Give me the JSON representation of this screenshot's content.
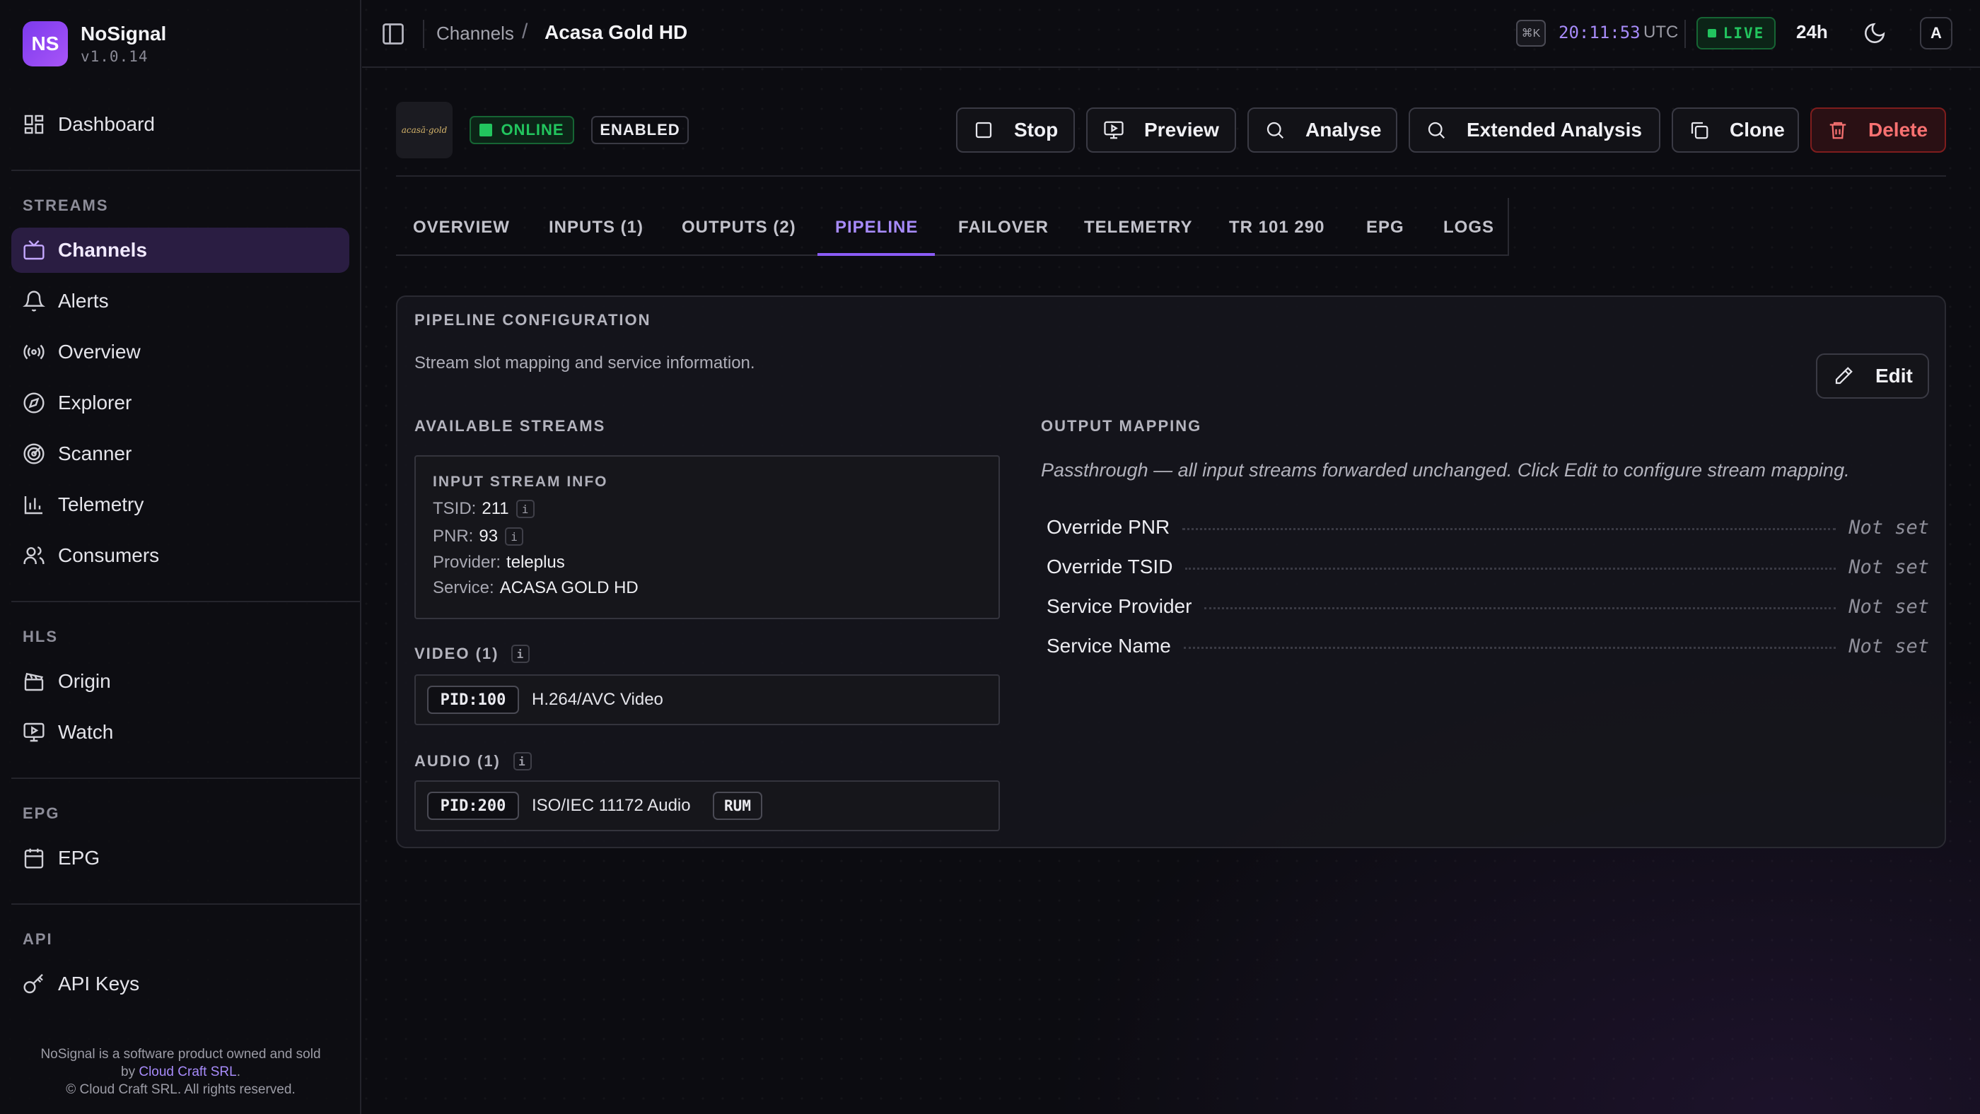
{
  "app": {
    "initials": "NS",
    "name": "NoSignal",
    "version": "v1.0.14"
  },
  "sidebar": {
    "dashboard": "Dashboard",
    "sections": {
      "streams": "STREAMS",
      "hls": "HLS",
      "epg": "EPG",
      "api": "API"
    },
    "streams": [
      "Channels",
      "Alerts",
      "Overview",
      "Explorer",
      "Scanner",
      "Telemetry",
      "Consumers"
    ],
    "hls": [
      "Origin",
      "Watch"
    ],
    "epg": [
      "EPG"
    ],
    "api": [
      "API Keys"
    ],
    "active": "Channels",
    "footer": {
      "line1": "NoSignal is a software product owned and sold",
      "by": "by",
      "company": "Cloud Craft SRL",
      "dot": ".",
      "copyright": "© Cloud Craft SRL. All rights reserved."
    }
  },
  "topbar": {
    "breadcrumb": [
      "Channels",
      "Acasa Gold HD"
    ],
    "separator": "/",
    "shortcut": "⌘K",
    "clock": "20:11:53",
    "timezone": "UTC",
    "live": "LIVE",
    "range": "24h",
    "avatar": "A"
  },
  "channel": {
    "logo_text": "acasă·gold",
    "status": "ONLINE",
    "state": "ENABLED",
    "actions": {
      "stop": "Stop",
      "preview": "Preview",
      "analyse": "Analyse",
      "extended": "Extended Analysis",
      "clone": "Clone",
      "delete": "Delete"
    }
  },
  "tabs": [
    "OVERVIEW",
    "INPUTS (1)",
    "OUTPUTS (2)",
    "PIPELINE",
    "FAILOVER",
    "TELEMETRY",
    "TR 101 290",
    "EPG",
    "LOGS"
  ],
  "active_tab": "PIPELINE",
  "pipeline": {
    "title": "PIPELINE CONFIGURATION",
    "subtitle": "Stream slot mapping and service information.",
    "edit": "Edit",
    "available_title": "AVAILABLE STREAMS",
    "input_info": {
      "title": "INPUT STREAM INFO",
      "tsid_label": "TSID:",
      "tsid": "211",
      "pnr_label": "PNR:",
      "pnr": "93",
      "provider_label": "Provider:",
      "provider": "teleplus",
      "service_label": "Service:",
      "service": "ACASA GOLD HD",
      "info_icon": "i"
    },
    "video": {
      "title": "VIDEO (1)",
      "pid": "PID:100",
      "codec": "H.264/AVC Video"
    },
    "audio": {
      "title": "AUDIO (1)",
      "pid": "PID:200",
      "codec": "ISO/IEC 11172 Audio",
      "lang": "RUM"
    },
    "output_mapping": {
      "title": "OUTPUT MAPPING",
      "note": "Passthrough — all input streams forwarded unchanged. Click Edit to configure stream mapping.",
      "rows": [
        {
          "label": "Override PNR",
          "value": "Not set"
        },
        {
          "label": "Override TSID",
          "value": "Not set"
        },
        {
          "label": "Service Provider",
          "value": "Not set"
        },
        {
          "label": "Service Name",
          "value": "Not set"
        }
      ]
    }
  },
  "colors": {
    "accent": "#a78bfa",
    "live": "#22c55e",
    "danger": "#f87171",
    "bg": "#0c0c11"
  }
}
